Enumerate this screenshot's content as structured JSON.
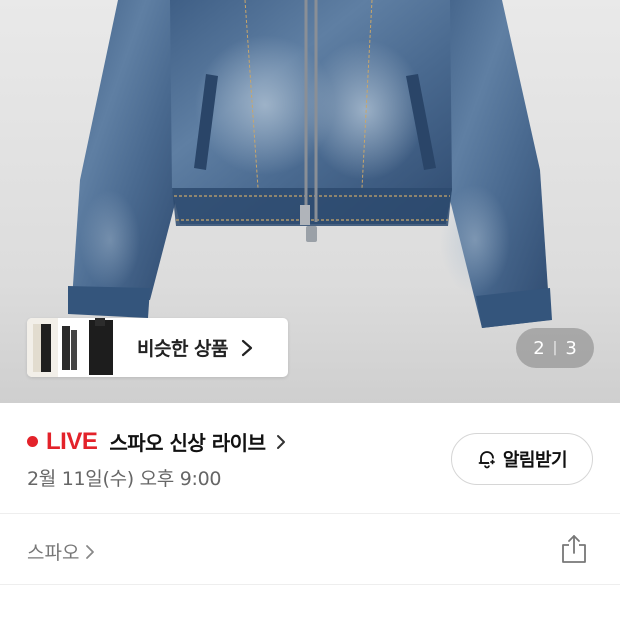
{
  "gallery": {
    "current_page": "2",
    "separator": "|",
    "total_pages": "3",
    "similar_products_label": "비슷한 상품"
  },
  "live": {
    "badge": "LIVE",
    "title": "스파오 신상 라이브",
    "schedule": "2월 11일(수) 오후 9:00",
    "notify_label": "알림받기",
    "accent_color": "#e3222a"
  },
  "brand": {
    "name": "스파오"
  },
  "icons": {
    "notify": "bell-plus-icon",
    "share": "share-icon",
    "chevron": "chevron-right-icon"
  }
}
